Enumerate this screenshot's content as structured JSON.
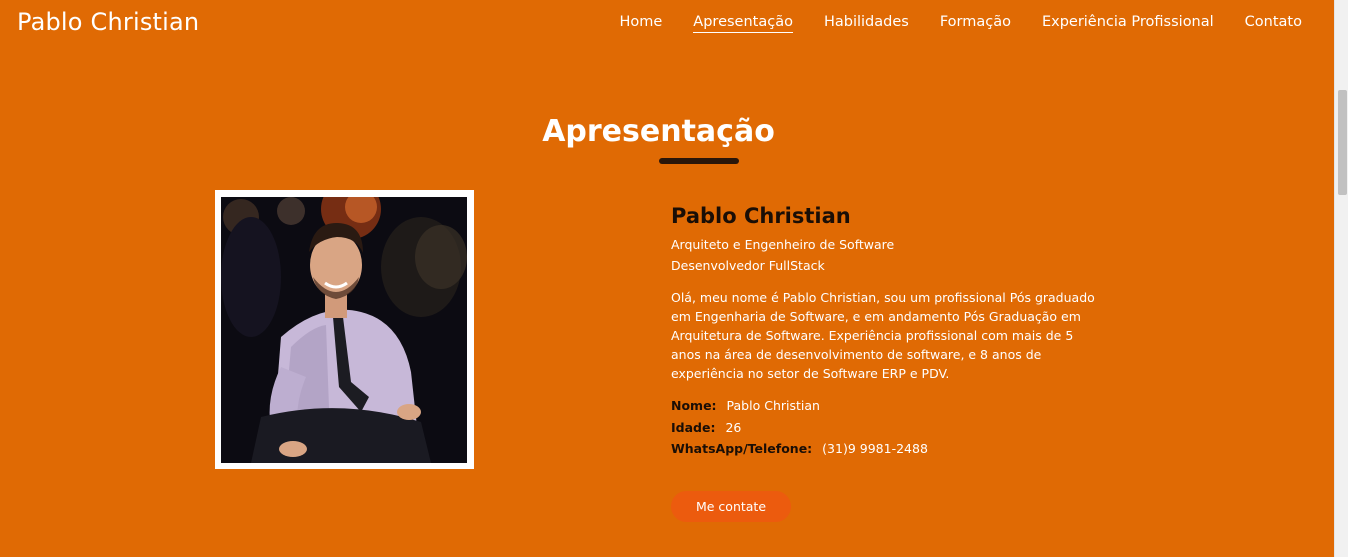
{
  "brand": "Pablo Christian",
  "nav": {
    "items": [
      {
        "label": "Home",
        "active": false
      },
      {
        "label": "Apresentação",
        "active": true
      },
      {
        "label": "Habilidades",
        "active": false
      },
      {
        "label": "Formação",
        "active": false
      },
      {
        "label": "Experiência Profissional",
        "active": false
      },
      {
        "label": "Contato",
        "active": false
      }
    ]
  },
  "section": {
    "title": "Apresentação"
  },
  "profile": {
    "name": "Pablo Christian",
    "role_1": "Arquiteto e Engenheiro de Software",
    "role_2": "Desenvolvedor FullStack",
    "description": "Olá, meu nome é Pablo Christian, sou um profissional Pós graduado em Engenharia de Software, e em andamento Pós Graduação em Arquitetura de Software. Experiência profissional com mais de 5 anos na área de desenvolvimento de software, e 8 anos de experiência no setor de Software ERP e PDV.",
    "details": [
      {
        "key": "Nome:",
        "value": "Pablo Christian"
      },
      {
        "key": "Idade:",
        "value": "26"
      },
      {
        "key": "WhatsApp/Telefone:",
        "value": "(31)9 9981-2488"
      }
    ],
    "cta_label": "Me contate"
  },
  "colors": {
    "background": "#e06a04",
    "button": "#ec5b0e",
    "dark_text": "#1a0e06",
    "underline": "#2a160a"
  }
}
